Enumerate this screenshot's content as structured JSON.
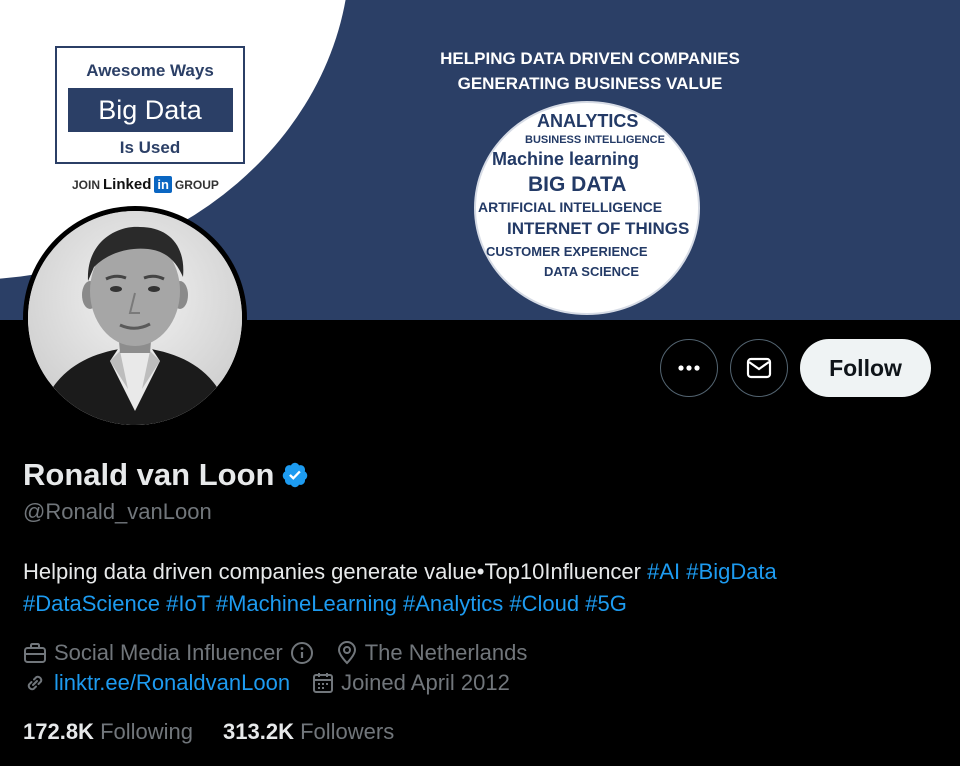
{
  "banner": {
    "promo_line1": "Awesome Ways",
    "promo_band": "Big Data",
    "promo_line3": "Is Used",
    "join_prefix": "JOIN",
    "join_brand": "Linked",
    "join_brand_box": "in",
    "join_suffix": "GROUP",
    "headline_line1": "HELPING DATA DRIVEN COMPANIES",
    "headline_line2": "GENERATING BUSINESS VALUE",
    "cloud": {
      "analytics": "ANALYTICS",
      "business_intelligence": "BUSINESS INTELLIGENCE",
      "machine_learning": "Machine learning",
      "big_data": "BIG DATA",
      "artificial_intelligence": "ARTIFICIAL INTELLIGENCE",
      "internet_of_things": "INTERNET OF THINGS",
      "customer_experience": "CUSTOMER EXPERIENCE",
      "data_science": "DATA SCIENCE"
    },
    "colors": {
      "navy": "#2b3f66",
      "white": "#ffffff",
      "linkedin": "#0a66c2"
    }
  },
  "actions": {
    "more_icon": "more-dots-icon",
    "message_icon": "envelope-icon",
    "follow_label": "Follow"
  },
  "profile": {
    "display_name": "Ronald van Loon",
    "verified_icon": "verified-badge-icon",
    "handle": "@Ronald_vanLoon",
    "bio_text": "Helping data driven companies generate value•Top10Influencer ",
    "hashtags": [
      "#AI",
      "#BigData",
      "#DataScience",
      "#IoT",
      "#MachineLearning",
      "#Analytics",
      "#Cloud",
      "#5G"
    ],
    "category": "Social Media Influencer",
    "location": "The Netherlands",
    "website": "linktr.ee/RonaldvanLoon",
    "joined": "Joined April 2012",
    "icons": {
      "category": "briefcase-icon",
      "info": "info-icon",
      "location": "location-pin-icon",
      "website": "link-icon",
      "joined": "calendar-icon"
    }
  },
  "stats": {
    "following_count": "172.8K",
    "following_label": "Following",
    "followers_count": "313.2K",
    "followers_label": "Followers"
  },
  "colors": {
    "background": "#000000",
    "text_primary": "#e7e9ea",
    "text_secondary": "#71767b",
    "link": "#1d9bf0",
    "follow_button_bg": "#eff3f4"
  }
}
